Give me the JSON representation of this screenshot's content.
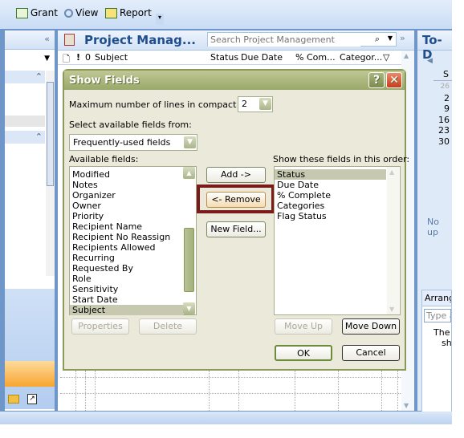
{
  "toolbar": {
    "items": [
      {
        "label": "Grant",
        "icon": "grant-icon"
      },
      {
        "label": "View",
        "icon": "view-icon"
      },
      {
        "label": "Report",
        "icon": "report-icon"
      }
    ]
  },
  "main": {
    "title": "Project Manag...",
    "search_placeholder": "Search Project Management",
    "columns": [
      "Subject",
      "Status",
      "Due Date",
      "% Com...",
      "Categor..."
    ]
  },
  "right": {
    "title": "To-D",
    "calendar_header": "S",
    "calendar_days": [
      "26",
      "2",
      "9",
      "16",
      "23",
      "30"
    ],
    "no_upcoming": "No up",
    "arrange": "Arrang",
    "type_placeholder": "Type a",
    "msg1": "The",
    "msg2": "sh"
  },
  "dialog": {
    "title": "Show Fields",
    "max_lines_label": "Maximum number of lines in compact mode:",
    "max_lines_value": "2",
    "select_from_label": "Select available fields from:",
    "select_from_value": "Frequently-used fields",
    "available_label": "Available fields:",
    "available": [
      "Modified",
      "Notes",
      "Organizer",
      "Owner",
      "Priority",
      "Recipient Name",
      "Recipient No Reassign",
      "Recipients Allowed",
      "Recurring",
      "Requested By",
      "Role",
      "Sensitivity",
      "Start Date",
      "Subject"
    ],
    "available_selected": "Subject",
    "shown_label": "Show these fields in this order:",
    "shown": [
      "Status",
      "Due Date",
      "% Complete",
      "Categories",
      "Flag Status"
    ],
    "shown_selected": "Status",
    "buttons": {
      "add": "Add ->",
      "remove": "<- Remove",
      "new_field": "New Field...",
      "properties": "Properties",
      "delete": "Delete",
      "move_up": "Move Up",
      "move_down": "Move Down",
      "ok": "OK",
      "cancel": "Cancel"
    },
    "highlight_color": "#7a1a1a"
  }
}
